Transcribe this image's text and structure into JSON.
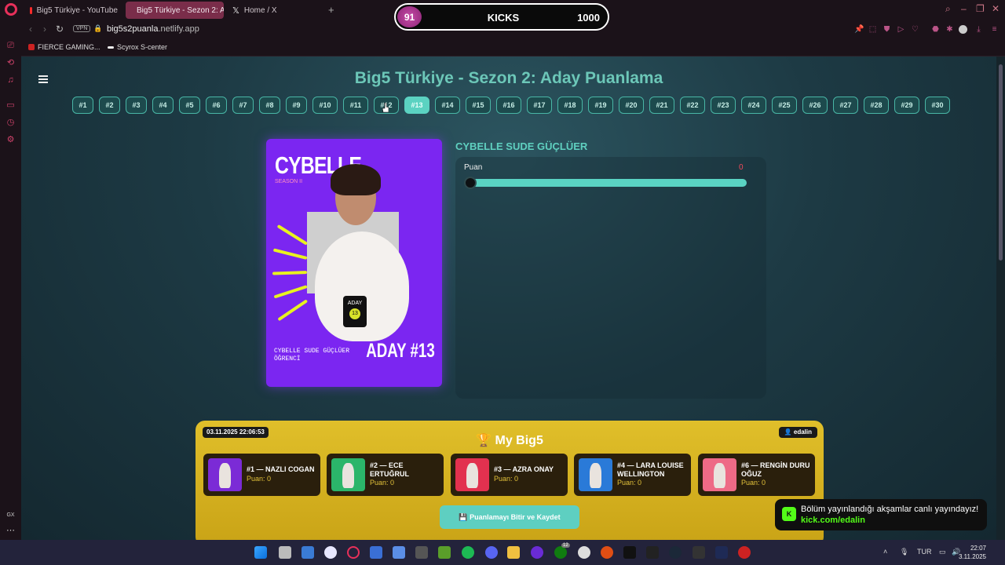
{
  "browser": {
    "tabs": [
      {
        "label": "Big5 Türkiye - YouTube",
        "icon": "youtube-icon",
        "active": false
      },
      {
        "label": "Big5 Türkiye - Sezon 2: A",
        "icon": "page-icon",
        "active": true
      },
      {
        "label": "Home / X",
        "icon": "x-icon",
        "active": false
      }
    ],
    "url_host": "big5s2puanla",
    "url_rest": ".netlify.app",
    "vpn_label": "VPN",
    "bookmarks": [
      "FIERCE GAMING...",
      "Scyrox S-center"
    ]
  },
  "kicks_overlay": {
    "badge": "91",
    "label": "KICKS",
    "total": "1000"
  },
  "page": {
    "title": "Big5 Türkiye - Sezon 2: Aday Puanlama",
    "numbers": [
      "#1",
      "#2",
      "#3",
      "#4",
      "#5",
      "#6",
      "#7",
      "#8",
      "#9",
      "#10",
      "#11",
      "#12",
      "#13",
      "#14",
      "#15",
      "#16",
      "#17",
      "#18",
      "#19",
      "#20",
      "#21",
      "#22",
      "#23",
      "#24",
      "#25",
      "#26",
      "#27",
      "#28",
      "#29",
      "#30"
    ],
    "selected_number": "#13",
    "card": {
      "name": "CYBELLE",
      "season": "SEASON II",
      "tag_top": "ADAY",
      "tag_num": "13",
      "full_name": "CYBELLE SUDE GÜÇLÜER",
      "role": "ÖĞRENCİ",
      "aday_label": "ADAY #13"
    },
    "candidate_name": "CYBELLE SUDE GÜÇLÜER",
    "score_label": "Puan",
    "score_value": "0",
    "score_fraction": 0
  },
  "big5": {
    "date": "03.11.2025 22:06:53",
    "user": "👤 edalin",
    "title": "🏆 My Big5",
    "picks": [
      {
        "title": "#1 — NAZLI COGAN",
        "score": "Puan: 0",
        "color": "#7b2bd6"
      },
      {
        "title": "#2 — ECE ERTUĞRUL",
        "score": "Puan: 0",
        "color": "#2bb56a"
      },
      {
        "title": "#3 — AZRA ONAY",
        "score": "Puan: 0",
        "color": "#e2314f"
      },
      {
        "title": "#4 — LARA LOUISE WELLINGTON",
        "score": "Puan: 0",
        "color": "#2a7ad8"
      },
      {
        "title": "#6 — RENGİN DURU OĞUZ",
        "score": "Puan: 0",
        "color": "#ee6a86"
      }
    ],
    "save_button": "💾 Puanlamayı Bitir ve Kaydet"
  },
  "toast": {
    "line1": "Bölüm yayınlandığı akşamlar canlı yayındayız!",
    "line2": "kick.com/edalin",
    "badge": "K"
  },
  "taskbar": {
    "lang": "TUR",
    "time": "22:07",
    "date": "3.11.2025",
    "xbox_badge": "12"
  },
  "sidebar_label": "GX"
}
